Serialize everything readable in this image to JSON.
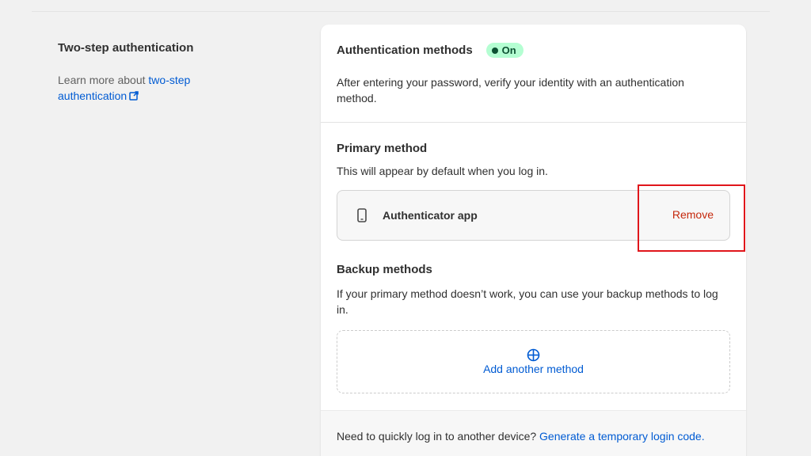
{
  "left": {
    "title": "Two-step authentication",
    "learn_prefix": "Learn more about ",
    "learn_link": "two-step authentication"
  },
  "card": {
    "title": "Authentication methods",
    "status_badge": "On",
    "description": "After entering your password, verify your identity with an authentication method.",
    "primary": {
      "title": "Primary method",
      "description": "This will appear by default when you log in.",
      "method_icon": "mobile-phone-icon",
      "method_label": "Authenticator app",
      "remove_label": "Remove"
    },
    "backup": {
      "title": "Backup methods",
      "description": "If your primary method doesn’t work, you can use your backup methods to log in.",
      "add_icon": "add-circle-icon",
      "add_label": "Add another method"
    },
    "footer": {
      "text": "Need to quickly log in to another device? ",
      "link": "Generate a temporary login code."
    }
  },
  "colors": {
    "link": "#005bd3",
    "remove": "#c5280c",
    "badge_bg": "#b4fed2",
    "highlight": "#e0161b"
  }
}
